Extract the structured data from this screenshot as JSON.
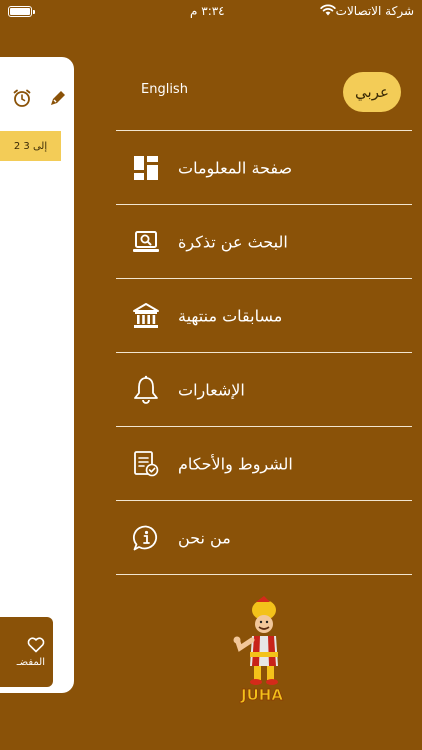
{
  "status_bar": {
    "time": "٣:٣٤ م",
    "carrier": "شركة الاتصالات"
  },
  "background_page": {
    "page_range": "2 إلى 3",
    "favorites_label": "المفضـ"
  },
  "language": {
    "english_label": "English",
    "arabic_label": "عربي"
  },
  "menu": {
    "items": [
      {
        "label": "صفحة المعلومات",
        "icon": "dashboard-grid-icon"
      },
      {
        "label": "البحث عن تذكرة",
        "icon": "search-laptop-icon"
      },
      {
        "label": "مسابقات منتهية",
        "icon": "bank-building-icon"
      },
      {
        "label": "الإشعارات",
        "icon": "bell-icon"
      },
      {
        "label": "الشروط والأحكام",
        "icon": "document-check-icon"
      },
      {
        "label": "من نحن",
        "icon": "info-chat-icon"
      }
    ]
  },
  "logo_text": "JUHA",
  "colors": {
    "background": "#8a5208",
    "accent": "#f3cc57",
    "card": "#ffffff"
  }
}
